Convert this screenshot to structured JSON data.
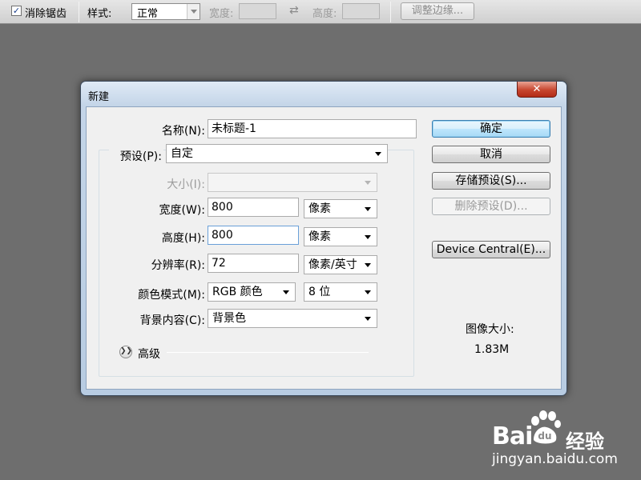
{
  "toolbar": {
    "antialias_checked": "✓",
    "antialias_label": "消除锯齿",
    "style_label": "样式:",
    "style_value": "正常",
    "width_label": "宽度:",
    "swap_glyph": "⇄",
    "height_label": "高度:",
    "refine_edge_label": "调整边缘..."
  },
  "dialog": {
    "title": "新建",
    "close_glyph": "✕",
    "name_label": "名称(N):",
    "name_value": "未标题-1",
    "preset_label": "预设(P):",
    "preset_value": "自定",
    "size_label": "大小(I):",
    "size_value": "",
    "width_label": "宽度(W):",
    "width_value": "800",
    "width_unit": "像素",
    "height_label": "高度(H):",
    "height_value": "800",
    "height_unit": "像素",
    "resolution_label": "分辨率(R):",
    "resolution_value": "72",
    "resolution_unit": "像素/英寸",
    "color_mode_label": "颜色模式(M):",
    "color_mode_value": "RGB 颜色",
    "bit_depth_value": "8 位",
    "background_label": "背景内容(C):",
    "background_value": "背景色",
    "advanced_label": "高级",
    "ok_label": "确定",
    "cancel_label": "取消",
    "save_preset_label": "存储预设(S)...",
    "delete_preset_label": "删除预设(D)...",
    "device_central_label": "Device Central(E)...",
    "image_size_label": "图像大小:",
    "image_size_value": "1.83M"
  },
  "watermark": {
    "brand": "Bai",
    "brand_suffix": "经验",
    "url": "jingyan.baidu.com"
  },
  "colors": {
    "app_background": "#6e6e6e",
    "title_bar": "#c4d5e8",
    "close_button": "#c7462f",
    "default_button": "#bee6fd"
  }
}
